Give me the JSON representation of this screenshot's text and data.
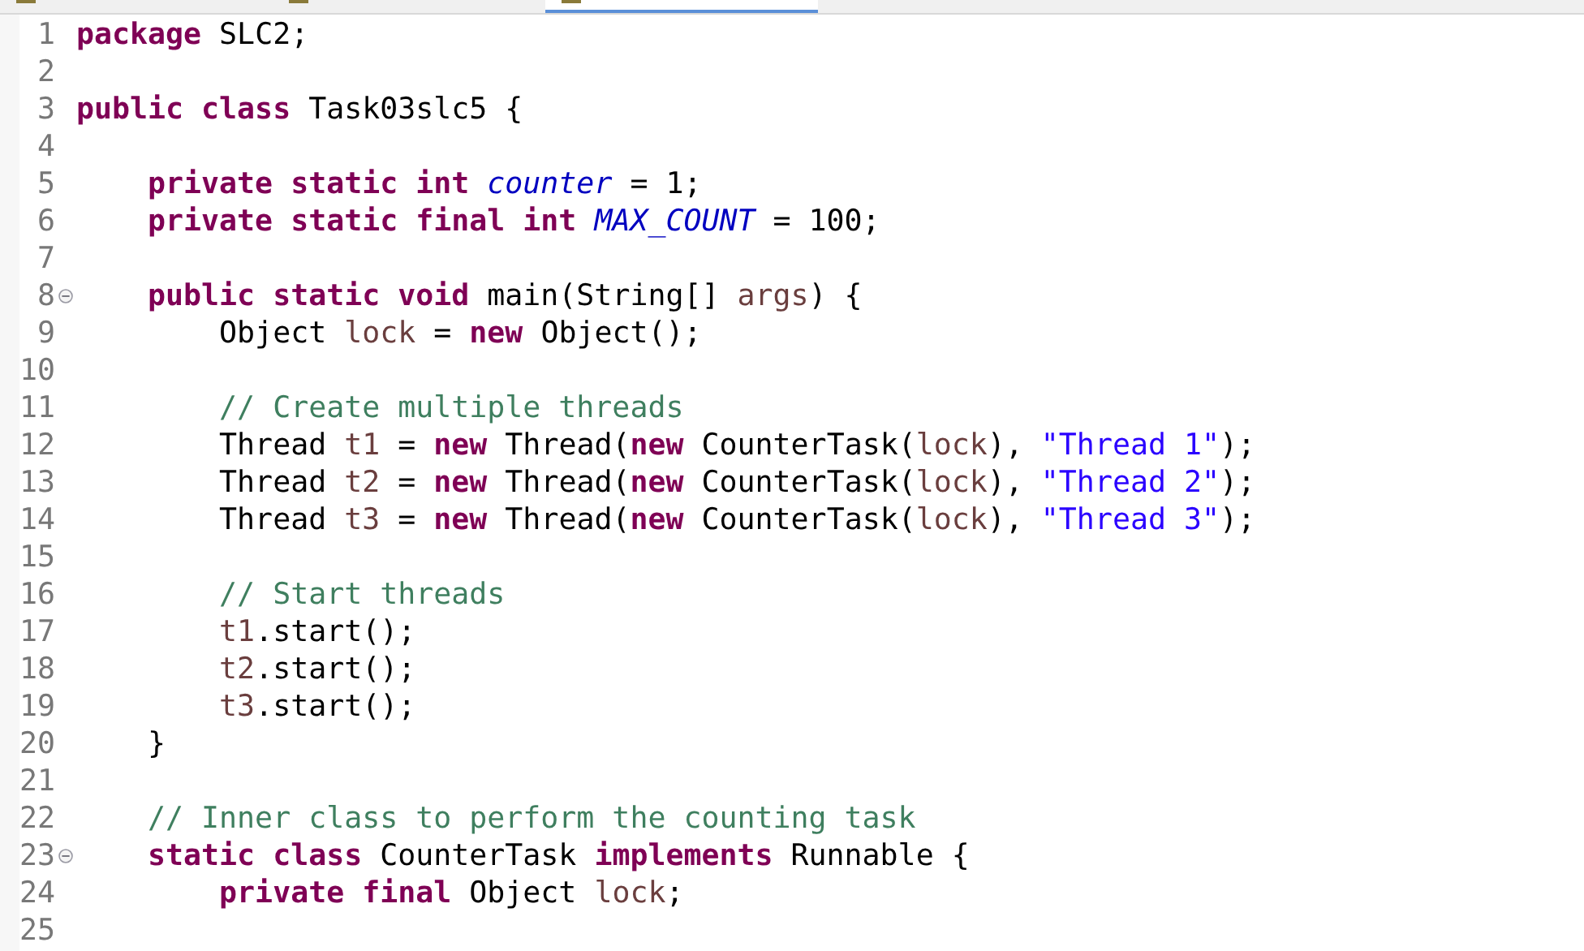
{
  "tabs": [
    {
      "selected": false
    },
    {
      "selected": false
    },
    {
      "selected": true
    }
  ],
  "lines": [
    {
      "number": "1",
      "foldable": false,
      "tokens": [
        {
          "kind": "keyword",
          "text": "package"
        },
        {
          "kind": "plain",
          "text": " SLC2;"
        }
      ]
    },
    {
      "number": "2",
      "foldable": false
    },
    {
      "number": "3",
      "foldable": false,
      "tokens": [
        {
          "kind": "keyword",
          "text": "public class"
        },
        {
          "kind": "plain",
          "text": " Task03slc5 {"
        }
      ]
    },
    {
      "number": "4",
      "foldable": false
    },
    {
      "number": "5",
      "foldable": false,
      "tokens": [
        {
          "kind": "keyword",
          "text": "    private static int "
        },
        {
          "kind": "field",
          "text": "counter"
        },
        {
          "kind": "plain",
          "text": " = 1;"
        }
      ]
    },
    {
      "number": "6",
      "foldable": false,
      "tokens": [
        {
          "kind": "keyword",
          "text": "    private static final int "
        },
        {
          "kind": "field",
          "text": "MAX_COUNT"
        },
        {
          "kind": "plain",
          "text": " = 100;"
        }
      ]
    },
    {
      "number": "7",
      "foldable": false
    },
    {
      "number": "8",
      "foldable": true,
      "tokens": [
        {
          "kind": "keyword",
          "text": "    public static void"
        },
        {
          "kind": "plain",
          "text": " main(String[] "
        },
        {
          "kind": "local",
          "text": "args"
        },
        {
          "kind": "plain",
          "text": ") {"
        }
      ]
    },
    {
      "number": "9",
      "foldable": false,
      "tokens": [
        {
          "kind": "plain",
          "text": "        Object "
        },
        {
          "kind": "local",
          "text": "lock"
        },
        {
          "kind": "plain",
          "text": " = "
        },
        {
          "kind": "keyword",
          "text": "new"
        },
        {
          "kind": "plain",
          "text": " Object();"
        }
      ]
    },
    {
      "number": "10",
      "foldable": false
    },
    {
      "number": "11",
      "foldable": false,
      "tokens": [
        {
          "kind": "comment",
          "text": "        // Create multiple threads"
        }
      ]
    },
    {
      "number": "12",
      "foldable": false,
      "tokens": [
        {
          "kind": "plain",
          "text": "        Thread "
        },
        {
          "kind": "local",
          "text": "t1"
        },
        {
          "kind": "plain",
          "text": " = "
        },
        {
          "kind": "keyword",
          "text": "new"
        },
        {
          "kind": "plain",
          "text": " Thread("
        },
        {
          "kind": "keyword",
          "text": "new"
        },
        {
          "kind": "plain",
          "text": " CounterTask("
        },
        {
          "kind": "local",
          "text": "lock"
        },
        {
          "kind": "plain",
          "text": "), "
        },
        {
          "kind": "string",
          "text": "\"Thread 1\""
        },
        {
          "kind": "plain",
          "text": ");"
        }
      ]
    },
    {
      "number": "13",
      "foldable": false,
      "tokens": [
        {
          "kind": "plain",
          "text": "        Thread "
        },
        {
          "kind": "local",
          "text": "t2"
        },
        {
          "kind": "plain",
          "text": " = "
        },
        {
          "kind": "keyword",
          "text": "new"
        },
        {
          "kind": "plain",
          "text": " Thread("
        },
        {
          "kind": "keyword",
          "text": "new"
        },
        {
          "kind": "plain",
          "text": " CounterTask("
        },
        {
          "kind": "local",
          "text": "lock"
        },
        {
          "kind": "plain",
          "text": "), "
        },
        {
          "kind": "string",
          "text": "\"Thread 2\""
        },
        {
          "kind": "plain",
          "text": ");"
        }
      ]
    },
    {
      "number": "14",
      "foldable": false,
      "tokens": [
        {
          "kind": "plain",
          "text": "        Thread "
        },
        {
          "kind": "local",
          "text": "t3"
        },
        {
          "kind": "plain",
          "text": " = "
        },
        {
          "kind": "keyword",
          "text": "new"
        },
        {
          "kind": "plain",
          "text": " Thread("
        },
        {
          "kind": "keyword",
          "text": "new"
        },
        {
          "kind": "plain",
          "text": " CounterTask("
        },
        {
          "kind": "local",
          "text": "lock"
        },
        {
          "kind": "plain",
          "text": "), "
        },
        {
          "kind": "string",
          "text": "\"Thread 3\""
        },
        {
          "kind": "plain",
          "text": ");"
        }
      ]
    },
    {
      "number": "15",
      "foldable": false
    },
    {
      "number": "16",
      "foldable": false,
      "tokens": [
        {
          "kind": "comment",
          "text": "        // Start threads"
        }
      ]
    },
    {
      "number": "17",
      "foldable": false,
      "tokens": [
        {
          "kind": "local",
          "text": "        t1"
        },
        {
          "kind": "plain",
          "text": ".start();"
        }
      ]
    },
    {
      "number": "18",
      "foldable": false,
      "tokens": [
        {
          "kind": "local",
          "text": "        t2"
        },
        {
          "kind": "plain",
          "text": ".start();"
        }
      ]
    },
    {
      "number": "19",
      "foldable": false,
      "tokens": [
        {
          "kind": "local",
          "text": "        t3"
        },
        {
          "kind": "plain",
          "text": ".start();"
        }
      ]
    },
    {
      "number": "20",
      "foldable": false,
      "tokens": [
        {
          "kind": "plain",
          "text": "    }"
        }
      ]
    },
    {
      "number": "21",
      "foldable": false
    },
    {
      "number": "22",
      "foldable": false,
      "tokens": [
        {
          "kind": "comment",
          "text": "    // Inner class to perform the counting task"
        }
      ]
    },
    {
      "number": "23",
      "foldable": true,
      "tokens": [
        {
          "kind": "keyword",
          "text": "    static class"
        },
        {
          "kind": "plain",
          "text": " CounterTask "
        },
        {
          "kind": "keyword",
          "text": "implements"
        },
        {
          "kind": "plain",
          "text": " Runnable {"
        }
      ]
    },
    {
      "number": "24",
      "foldable": false,
      "tokens": [
        {
          "kind": "keyword",
          "text": "        private final"
        },
        {
          "kind": "plain",
          "text": " Object "
        },
        {
          "kind": "local",
          "text": "lock"
        },
        {
          "kind": "plain",
          "text": ";"
        }
      ]
    },
    {
      "number": "25",
      "foldable": false
    }
  ]
}
